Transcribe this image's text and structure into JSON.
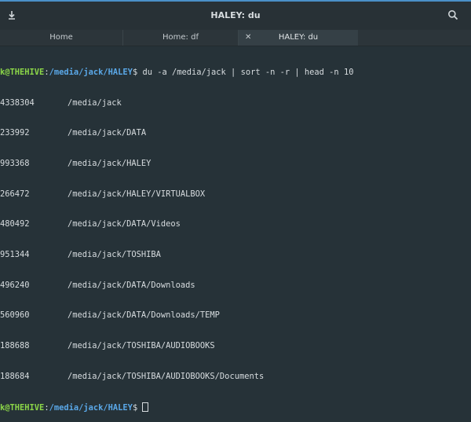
{
  "window": {
    "title": "HALEY: du"
  },
  "icons": {
    "left": "download-icon",
    "right": "search-icon"
  },
  "tabs": [
    {
      "label": "Home"
    },
    {
      "label": "Home: df"
    },
    {
      "label": "HALEY: du",
      "close": "✕"
    }
  ],
  "terminal": {
    "prompt1": {
      "user": "k@THEHIVE",
      "sep": ":",
      "path": "/media/jack/HALEY",
      "symbol": "$",
      "command": " du -a /media/jack | sort -n -r | head -n 10"
    },
    "rows": [
      {
        "size": "4338304",
        "path": "/media/jack"
      },
      {
        "size": "233992",
        "path": "/media/jack/DATA"
      },
      {
        "size": "993368",
        "path": "/media/jack/HALEY"
      },
      {
        "size": "266472",
        "path": "/media/jack/HALEY/VIRTUALBOX"
      },
      {
        "size": "480492",
        "path": "/media/jack/DATA/Videos"
      },
      {
        "size": "951344",
        "path": "/media/jack/TOSHIBA"
      },
      {
        "size": "496240",
        "path": "/media/jack/DATA/Downloads"
      },
      {
        "size": "560960",
        "path": "/media/jack/DATA/Downloads/TEMP"
      },
      {
        "size": "188688",
        "path": "/media/jack/TOSHIBA/AUDIOBOOKS"
      },
      {
        "size": "188684",
        "path": "/media/jack/TOSHIBA/AUDIOBOOKS/Documents"
      }
    ],
    "prompt2": {
      "user": "k@THEHIVE",
      "sep": ":",
      "path": "/media/jack/HALEY",
      "symbol": "$ "
    }
  },
  "colors": {
    "background": "#263238",
    "user": "#8bd648",
    "path": "#5aa8e8",
    "accent": "#4a90c8"
  }
}
